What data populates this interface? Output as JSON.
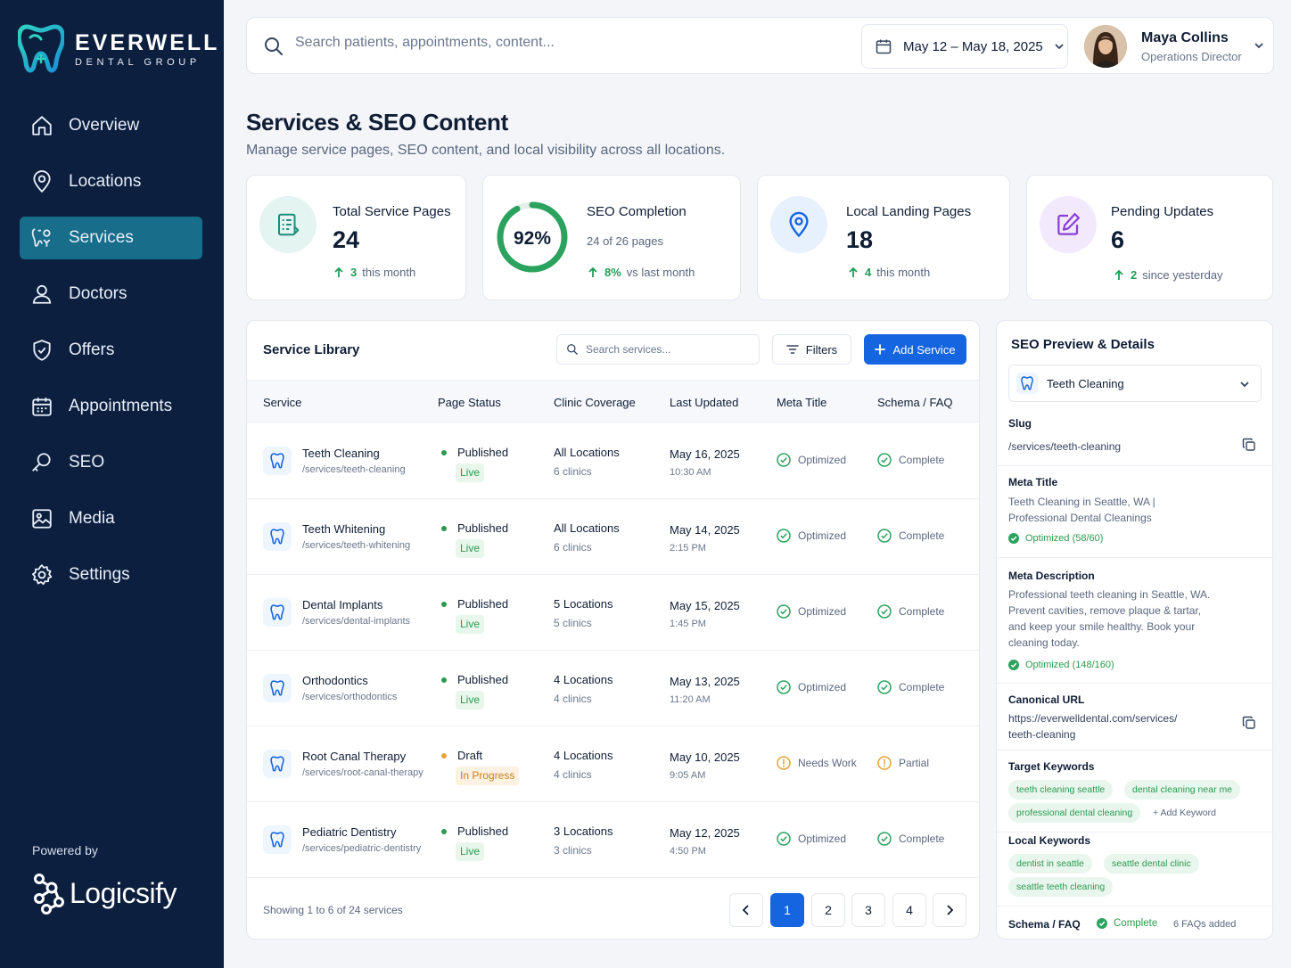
{
  "brand": {
    "name": "EVERWELL",
    "sub": "DENTAL GROUP",
    "powered_by": "Powered by",
    "partner": "Logicsify"
  },
  "nav": [
    {
      "label": "Overview",
      "icon": "home-icon",
      "active": false
    },
    {
      "label": "Locations",
      "icon": "location-pin-icon",
      "active": false
    },
    {
      "label": "Services",
      "icon": "tooth-services-icon",
      "active": true
    },
    {
      "label": "Doctors",
      "icon": "user-icon",
      "active": false
    },
    {
      "label": "Offers",
      "icon": "badge-check-icon",
      "active": false
    },
    {
      "label": "Appointments",
      "icon": "calendar-icon",
      "active": false
    },
    {
      "label": "SEO",
      "icon": "search-key-icon",
      "active": false
    },
    {
      "label": "Media",
      "icon": "image-icon",
      "active": false
    },
    {
      "label": "Settings",
      "icon": "gear-icon",
      "active": false
    }
  ],
  "topbar": {
    "search_placeholder": "Search patients, appointments, content...",
    "date_range": "May 12 – May 18, 2025",
    "user_name": "Maya Collins",
    "user_role": "Operations Director"
  },
  "page": {
    "title": "Services & SEO Content",
    "subtitle": "Manage service pages, SEO content, and local visibility across all locations."
  },
  "stats": [
    {
      "label": "Total Service Pages",
      "value": "24",
      "delta": "3",
      "delta_text": "this month"
    },
    {
      "label": "SEO Completion",
      "value": "92%",
      "progress": 0.92,
      "sub": "24 of 26 pages",
      "delta": "8%",
      "delta_text": "vs last month"
    },
    {
      "label": "Local Landing Pages",
      "value": "18",
      "delta": "4",
      "delta_text": "this month"
    },
    {
      "label": "Pending Updates",
      "value": "6",
      "delta": "2",
      "delta_text": "since yesterday"
    }
  ],
  "library": {
    "title": "Service Library",
    "search_placeholder": "Search services...",
    "filters_label": "Filters",
    "add_label": "Add Service",
    "columns": [
      "Service",
      "Page Status",
      "Clinic Coverage",
      "Last Updated",
      "Meta Title",
      "Schema / FAQ"
    ],
    "rows": [
      {
        "name": "Teeth Cleaning",
        "slug": "/services/teeth-cleaning",
        "status": "Published",
        "badge": "Live",
        "coverage": "All Locations",
        "clinics": "6 clinics",
        "date": "May 16, 2025",
        "time": "10:30 AM",
        "meta": "Optimized",
        "schema": "Complete"
      },
      {
        "name": "Teeth Whitening",
        "slug": "/services/teeth-whitening",
        "status": "Published",
        "badge": "Live",
        "coverage": "All Locations",
        "clinics": "6 clinics",
        "date": "May 14, 2025",
        "time": "2:15 PM",
        "meta": "Optimized",
        "schema": "Complete"
      },
      {
        "name": "Dental Implants",
        "slug": "/services/dental-implants",
        "status": "Published",
        "badge": "Live",
        "coverage": "5 Locations",
        "clinics": "5 clinics",
        "date": "May 15, 2025",
        "time": "1:45 PM",
        "meta": "Optimized",
        "schema": "Complete"
      },
      {
        "name": "Orthodontics",
        "slug": "/services/orthodontics",
        "status": "Published",
        "badge": "Live",
        "coverage": "4 Locations",
        "clinics": "4 clinics",
        "date": "May 13, 2025",
        "time": "11:20 AM",
        "meta": "Optimized",
        "schema": "Complete"
      },
      {
        "name": "Root Canal Therapy",
        "slug": "/services/root-canal-therapy",
        "status": "Draft",
        "badge": "In Progress",
        "coverage": "4 Locations",
        "clinics": "4 clinics",
        "date": "May 10, 2025",
        "time": "9:05 AM",
        "meta": "Needs Work",
        "schema": "Partial"
      },
      {
        "name": "Pediatric Dentistry",
        "slug": "/services/pediatric-dentistry",
        "status": "Published",
        "badge": "Live",
        "coverage": "3 Locations",
        "clinics": "3 clinics",
        "date": "May 12, 2025",
        "time": "4:50 PM",
        "meta": "Optimized",
        "schema": "Complete"
      }
    ],
    "footer": "Showing 1 to 6 of 24 services",
    "pages": [
      "1",
      "2",
      "3",
      "4"
    ],
    "current_page": "1"
  },
  "seo": {
    "title": "SEO Preview & Details",
    "selected": "Teeth Cleaning",
    "slug_label": "Slug",
    "slug": "/services/teeth-cleaning",
    "meta_title_label": "Meta Title",
    "meta_title_1": "Teeth Cleaning in Seattle, WA  |",
    "meta_title_2": "Professional Dental Cleanings",
    "meta_title_status": "Optimized (58/60)",
    "meta_desc_label": "Meta Description",
    "meta_desc_1": "Professional teeth cleaning in Seattle, WA.",
    "meta_desc_2": "Prevent cavities, remove plaque & tartar,",
    "meta_desc_3": "and keep your smile healthy. Book your",
    "meta_desc_4": "cleaning today.",
    "meta_desc_status": "Optimized (148/160)",
    "canonical_label": "Canonical URL",
    "canonical_1": "https://everwelldental.com/services/",
    "canonical_2": "teeth-cleaning",
    "target_label": "Target Keywords",
    "target_keywords": [
      "teeth cleaning seattle",
      "dental cleaning near me",
      "professional dental cleaning"
    ],
    "add_keyword": "+ Add Keyword",
    "local_label": "Local Keywords",
    "local_keywords": [
      "dentist in seattle",
      "seattle dental clinic",
      "seattle teeth cleaning"
    ],
    "schema_label": "Schema / FAQ",
    "schema_status": "Complete",
    "schema_faqs": "6 FAQs added"
  },
  "colors": {
    "sidebar": "#0c1f3f",
    "active_nav": "#176d8a",
    "primary": "#1565e0",
    "success": "#2b9a4e",
    "warning": "#e8a23a"
  }
}
